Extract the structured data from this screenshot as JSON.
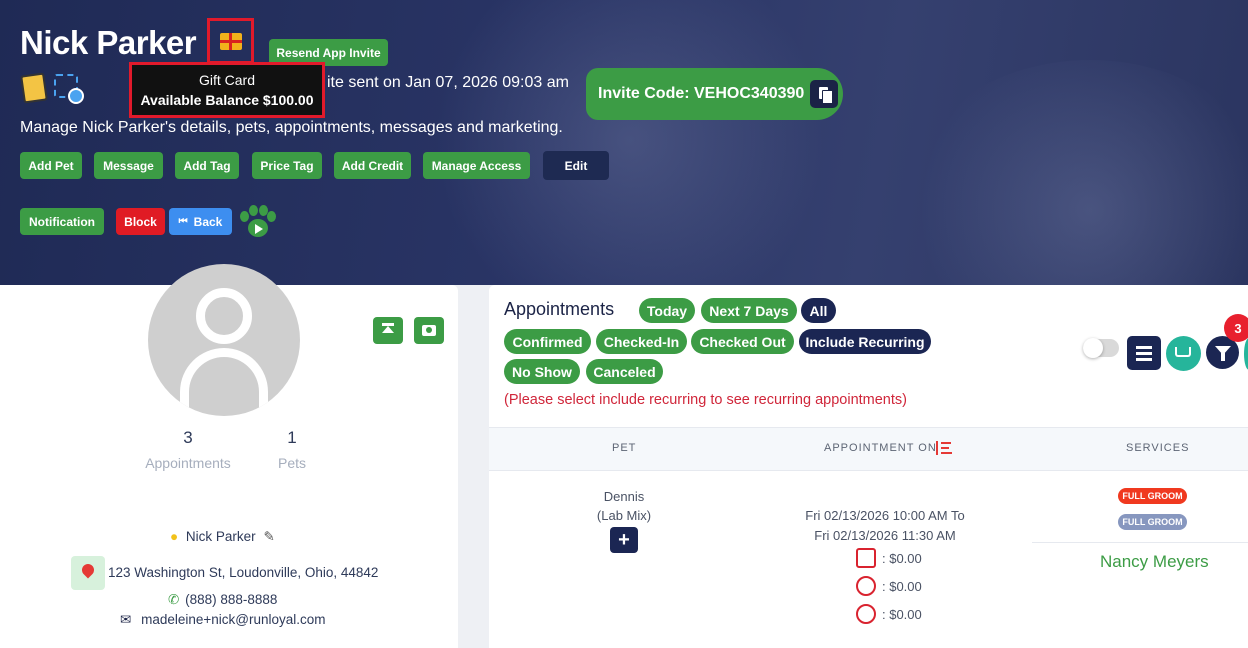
{
  "header": {
    "customer_name": "Nick Parker",
    "resend_invite": "Resend App Invite",
    "invite_sent_text": "ite sent on Jan 07, 2026 09:03 am",
    "invite_code": "Invite Code: VEHOC340390",
    "description": "Manage Nick Parker's details, pets, appointments, messages and marketing.",
    "tooltip": {
      "line1": "Gift Card",
      "line2": "Available Balance $100.00"
    },
    "actions": [
      "Add Pet",
      "Message",
      "Add Tag",
      "Price Tag",
      "Add Credit",
      "Manage Access",
      "Edit"
    ],
    "actions2": {
      "notification": "Notification",
      "block": "Block",
      "back": "Back"
    }
  },
  "profile": {
    "appointments_count": "3",
    "appointments_label": "Appointments",
    "pets_count": "1",
    "pets_label": "Pets",
    "name": "Nick Parker",
    "address": "123 Washington St, Loudonville, Ohio, 44842",
    "phone": "(888) 888-8888",
    "email": "madeleine+nick@runloyal.com"
  },
  "appointments": {
    "title": "Appointments",
    "filters_row1": [
      "Today",
      "Next 7 Days",
      "All"
    ],
    "filters_row2": [
      "Confirmed",
      "Checked-In",
      "Checked Out",
      "Include Recurring"
    ],
    "filters_row3": [
      "No Show",
      "Canceled"
    ],
    "recurring_note": "(Please select include recurring to see recurring appointments)",
    "filter_badge": "3",
    "columns": {
      "pet": "PET",
      "appointment_on": "APPOINTMENT ON",
      "services": "SERVICES"
    },
    "rows": [
      {
        "pet_name": "Dennis",
        "pet_breed": "(Lab Mix)",
        "time_line1": "Fri 02/13/2026 10:00 AM To",
        "time_line2": "Fri 02/13/2026 11:30 AM",
        "invoice": ": $0.00",
        "tip": ": $0.00",
        "deposit": ": $0.00",
        "service_tag1": "FULL GROOM",
        "service_tag2": "FULL GROOM",
        "staff": "Nancy Meyers"
      }
    ]
  },
  "colors": {
    "primary_green": "#3c9c45",
    "navy": "#1b2653",
    "danger_red": "#e11a2b",
    "teal": "#26b59b"
  }
}
